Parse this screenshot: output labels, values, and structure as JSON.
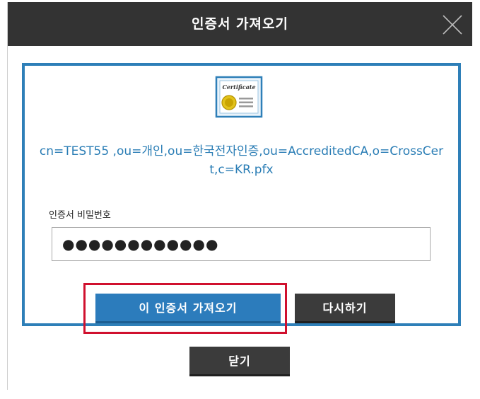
{
  "dialog": {
    "title": "인증서 가져오기",
    "close_icon": "close-x-icon"
  },
  "certificate": {
    "icon": "certificate-icon",
    "icon_caption": "Certificate",
    "name": "cn=TEST55 ,ou=개인,ou=한국전자인증,ou=AccreditedCA,o=CrossCert,c=KR.pfx"
  },
  "password": {
    "label": "인증서 비밀번호",
    "value": "●●●●●●●●●●●●"
  },
  "buttons": {
    "import_label": "이 인증서 가져오기",
    "retry_label": "다시하기",
    "close_label": "닫기"
  },
  "colors": {
    "titlebar": "#333333",
    "accent_blue": "#2e7fb8",
    "dark_button": "#3b3b3b",
    "highlight_red": "#d0102e"
  }
}
